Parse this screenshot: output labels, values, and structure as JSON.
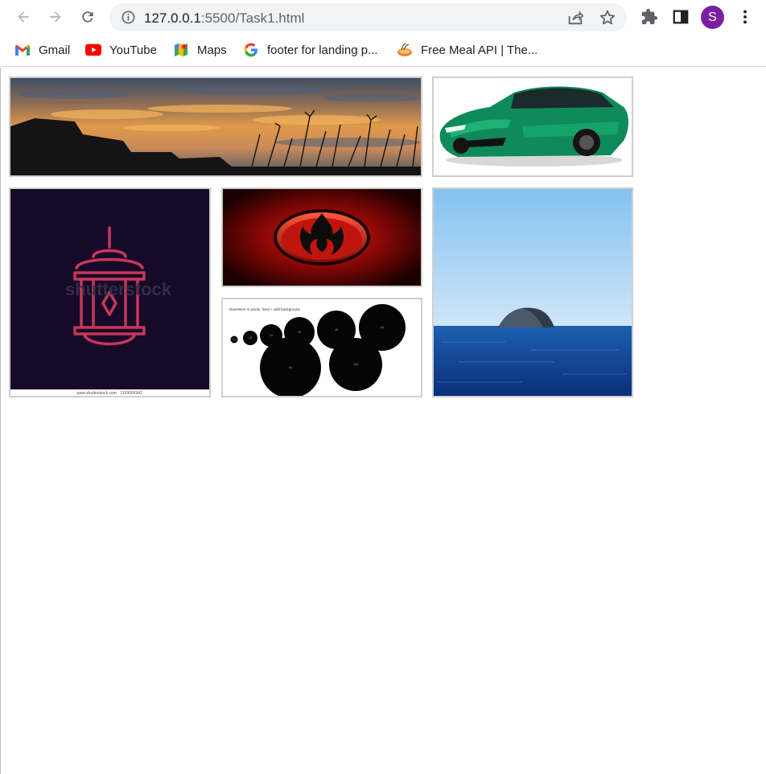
{
  "browser": {
    "url_host": "127.0.0.1",
    "url_path": ":5500/Task1.html",
    "profile_initial": "S"
  },
  "bookmarks": [
    {
      "label": "Gmail",
      "icon": "gmail-icon"
    },
    {
      "label": "YouTube",
      "icon": "youtube-icon"
    },
    {
      "label": "Maps",
      "icon": "maps-icon"
    },
    {
      "label": "footer for landing p...",
      "icon": "google-icon"
    },
    {
      "label": "Free Meal API | The...",
      "icon": "meal-icon"
    }
  ],
  "gallery": {
    "lantern_watermark": "shutterstock",
    "lantern_footer": "www.shutterstock.com · 1159006942",
    "circles_caption": "Diameters in pixels, fixed + wild background",
    "circle_labels": [
      "12",
      "18",
      "24",
      "36",
      "48",
      "64",
      "96",
      "128"
    ]
  },
  "colors": {
    "profile": "#7b1fa2",
    "tile_border": "#cfcfcf"
  }
}
